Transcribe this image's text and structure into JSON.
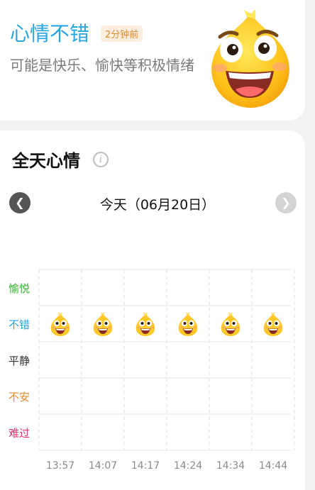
{
  "current": {
    "mood": "心情不错",
    "time_ago": "2分钟前",
    "description": "可能是快乐、愉快等积极情绪",
    "icon": "happy-face-icon"
  },
  "daily": {
    "title": "全天心情",
    "info_icon": "info-icon",
    "date": "今天（06月20日）",
    "prev_icon": "chevron-left-icon",
    "next_icon": "chevron-right-icon",
    "levels": [
      {
        "label": "愉悦",
        "color": "#2bb52b"
      },
      {
        "label": "不错",
        "color": "#27a5e0"
      },
      {
        "label": "平静",
        "color": "#333333"
      },
      {
        "label": "不安",
        "color": "#e38a2b"
      },
      {
        "label": "难过",
        "color": "#e0306e"
      }
    ],
    "times": [
      "13:57",
      "14:07",
      "14:17",
      "14:24",
      "14:34",
      "14:44"
    ],
    "readings": [
      "不错",
      "不错",
      "不错",
      "不错",
      "不错",
      "不错"
    ]
  }
}
